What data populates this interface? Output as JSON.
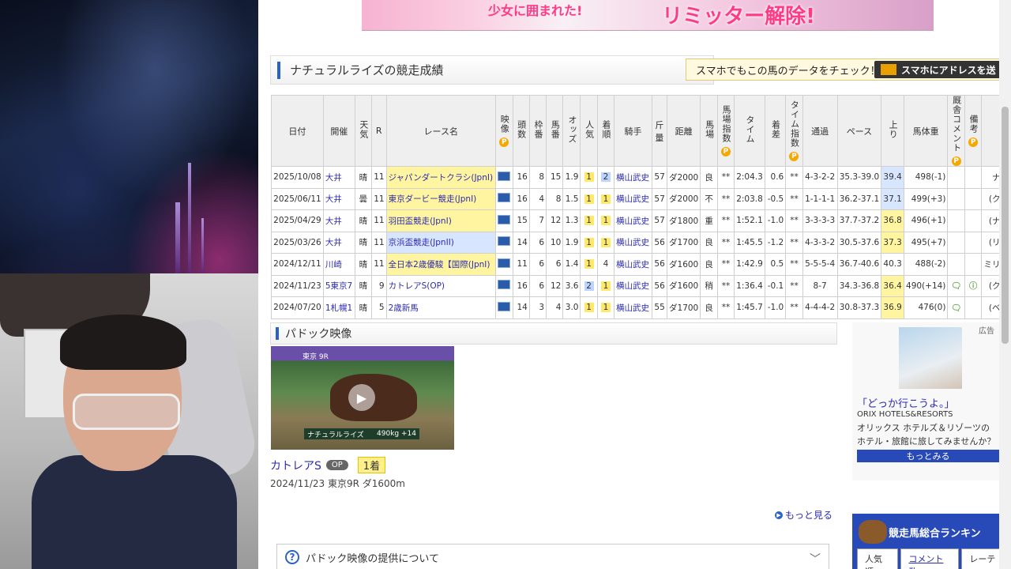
{
  "banner": {
    "left_text": "少女に囲まれた!",
    "right_text": "リミッター解除!"
  },
  "results_section": {
    "title": "ナチュラルライズの競走成績",
    "smartphone_text": "スマホでもこの馬のデータをチェック！",
    "smartphone_button": "スマホにアドレスを送"
  },
  "results_table": {
    "headers": [
      "日付",
      "開催",
      "天気",
      "R",
      "レース名",
      "映像",
      "頭数",
      "枠番",
      "馬番",
      "オッズ",
      "人気",
      "着順",
      "騎手",
      "斤量",
      "距離",
      "馬場",
      "馬場指数",
      "タイム",
      "着差",
      "タイム指数",
      "通過",
      "ペース",
      "上り",
      "馬体重",
      "厩舎コメント",
      "備考",
      ""
    ],
    "rows": [
      [
        "2025/10/08",
        "大井",
        "晴",
        "11",
        "ジャパンダートクラシ(JpnI)",
        "",
        "16",
        "8",
        "15",
        "1.9",
        "1",
        "2",
        "横山武史",
        "57",
        "ダ2000",
        "良",
        "**",
        "2:04.3",
        "0.6",
        "**",
        "4-3-2-2",
        "35.3-39.0",
        "39.4",
        "498(-1)",
        "",
        "",
        "ナル"
      ],
      [
        "2025/06/11",
        "大井",
        "曇",
        "11",
        "東京ダービー競走(JpnI)",
        "",
        "16",
        "4",
        "8",
        "1.5",
        "1",
        "1",
        "横山武史",
        "57",
        "ダ2000",
        "不",
        "**",
        "2:03.8",
        "-0.5",
        "**",
        "1-1-1-1",
        "36.2-37.1",
        "37.1",
        "499(+3)",
        "",
        "",
        "(クレ"
      ],
      [
        "2025/04/29",
        "大井",
        "晴",
        "11",
        "羽田盃競走(JpnI)",
        "",
        "15",
        "7",
        "12",
        "1.3",
        "1",
        "1",
        "横山武史",
        "57",
        "ダ1800",
        "重",
        "**",
        "1:52.1",
        "-1.0",
        "**",
        "3-3-3-3",
        "37.7-37.2",
        "36.8",
        "496(+1)",
        "",
        "",
        "(ナイ"
      ],
      [
        "2025/03/26",
        "大井",
        "晴",
        "11",
        "京浜盃競走(JpnII)",
        "",
        "14",
        "6",
        "10",
        "1.9",
        "1",
        "1",
        "横山武史",
        "56",
        "ダ1700",
        "良",
        "**",
        "1:45.5",
        "-1.2",
        "**",
        "4-3-3-2",
        "30.5-37.6",
        "37.3",
        "495(+7)",
        "",
        "",
        "(リコ"
      ],
      [
        "2024/12/11",
        "川崎",
        "晴",
        "11",
        "全日本2歳優駿【国際(JpnI)",
        "",
        "11",
        "6",
        "6",
        "1.4",
        "1",
        "4",
        "横山武史",
        "56",
        "ダ1600",
        "良",
        "**",
        "1:42.9",
        "0.5",
        "**",
        "5-5-5-4",
        "36.7-40.6",
        "40.3",
        "488(-2)",
        "",
        "",
        "ミリフ"
      ],
      [
        "2024/11/23",
        "5東京7",
        "晴",
        "9",
        "カトレアS(OP)",
        "",
        "16",
        "6",
        "12",
        "3.6",
        "2",
        "1",
        "横山武史",
        "56",
        "ダ1600",
        "稍",
        "**",
        "1:36.4",
        "-0.1",
        "**",
        "8-7",
        "34.3-36.8",
        "36.4",
        "490(+14)",
        "",
        "",
        "(クレ"
      ],
      [
        "2024/07/20",
        "1札幌1",
        "晴",
        "5",
        "2歳新馬",
        "",
        "14",
        "3",
        "4",
        "3.0",
        "1",
        "1",
        "横山武史",
        "55",
        "ダ1700",
        "良",
        "**",
        "1:45.7",
        "-1.0",
        "**",
        "4-4-4-2",
        "30.8-37.3",
        "36.9",
        "476(0)",
        "",
        "",
        "(ベル"
      ]
    ]
  },
  "paddock": {
    "title": "パドック映像",
    "thumb_top": "東京 9R",
    "thumb_caption_name": "ナチュラルライズ",
    "thumb_caption_weight": "490kg +14",
    "race_name": "カトレアS",
    "grade": "OP",
    "rank": "1着",
    "info": "2024/11/23 東京9R ダ1600m",
    "more": "もっと見る",
    "faq": "パドック映像の提供について"
  },
  "ad": {
    "label": "広告",
    "headline": "「どっか行こうよ。」",
    "brand": "ORIX HOTELS&RESORTS",
    "body": "オリックス ホテルズ＆リゾーツのホテル・旅館に旅してみませんか？",
    "button": "もっとみる"
  },
  "ranking": {
    "title": "競走馬総合ランキン",
    "tabs": [
      "人気順",
      "コメント数",
      "レーティ"
    ]
  }
}
